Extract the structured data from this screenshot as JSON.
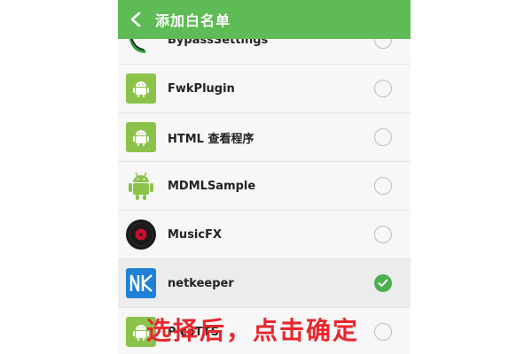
{
  "header": {
    "title": "添加白名单",
    "back_icon": "chevron-left-icon",
    "color": "#5fbb55"
  },
  "apps": [
    {
      "name": "BypassSettings",
      "icon": "bypass-app-icon",
      "selected": false
    },
    {
      "name": "FwkPlugin",
      "icon": "android-icon",
      "selected": false
    },
    {
      "name": "HTML 查看程序",
      "icon": "android-icon",
      "selected": false
    },
    {
      "name": "MDMLSample",
      "icon": "android-robot-icon",
      "selected": false
    },
    {
      "name": "MusicFX",
      "icon": "vinyl-record-icon",
      "selected": false
    },
    {
      "name": "netkeeper",
      "icon": "netkeeper-nk-icon",
      "selected": true
    },
    {
      "name": "PicoTTS",
      "icon": "android-icon",
      "selected": false
    }
  ],
  "overlay": {
    "caption": "选择后，点击确定",
    "color": "#e8262d"
  },
  "colors": {
    "checked": "#4caf50",
    "android_green": "#8bc34a"
  }
}
